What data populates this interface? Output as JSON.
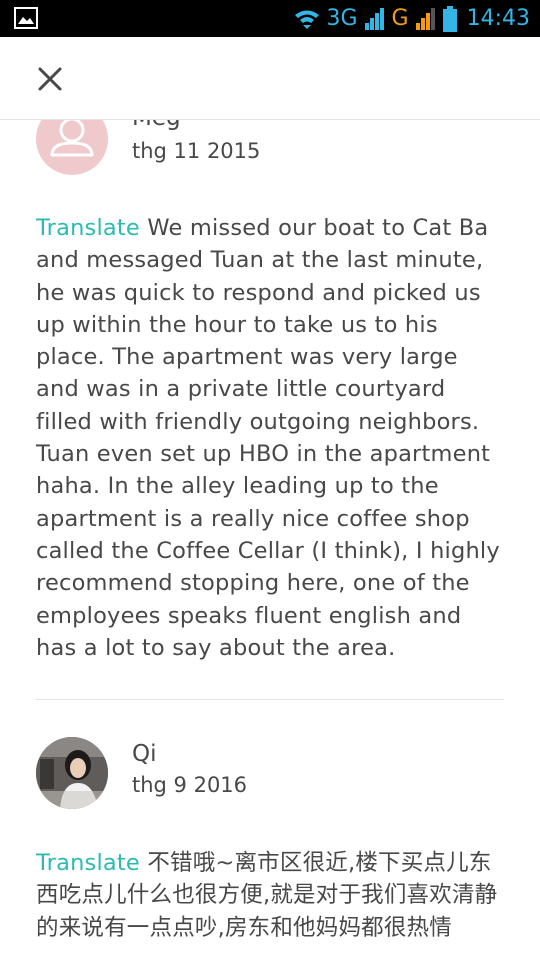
{
  "status_bar": {
    "network": "3G",
    "network2": "G",
    "time": "14:43"
  },
  "header": {
    "close_icon": "close-icon"
  },
  "reviews": [
    {
      "name": "Meg",
      "date": "thg 11 2015",
      "translate_label": "Translate",
      "text": "We missed our boat to Cat Ba and messaged Tuan at the last minute, he was quick to respond and picked us up within the hour to take us to his place. The apartment was very large and was in a private little courtyard filled with friendly outgoing neighbors. Tuan even set up HBO in the apartment haha. In the alley leading up to the apartment is a really nice coffee shop called the Coffee Cellar (I think), I highly recommend stopping here, one of the employees speaks fluent english and has a lot to say about the area."
    },
    {
      "name": "Qi",
      "date": "thg 9 2016",
      "translate_label": "Translate",
      "text": "不错哦~离市区很近,楼下买点儿东西吃点儿什么也很方便,就是对于我们喜欢清静的来说有一点点吵,房东和他妈妈都很热情"
    }
  ],
  "colors": {
    "accent": "#2bbcb1",
    "text": "#484848",
    "status_icons": "#33b5e5",
    "avatar_placeholder": "#f0c9cc"
  }
}
